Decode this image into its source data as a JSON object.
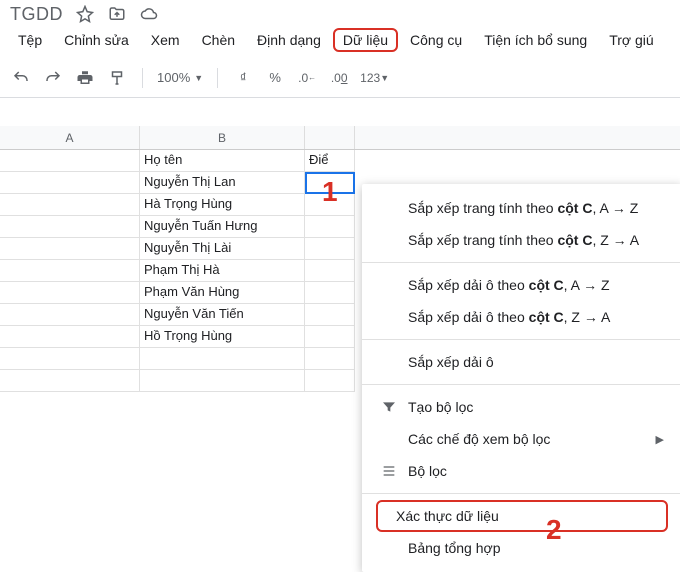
{
  "title": "TGDD",
  "menubar": [
    "Tệp",
    "Chỉnh sửa",
    "Xem",
    "Chèn",
    "Định dạng",
    "Dữ liệu",
    "Công cụ",
    "Tiện ích bổ sung",
    "Trợ giú"
  ],
  "menubar_highlight_index": 5,
  "toolbar": {
    "zoom": "100%",
    "currency": "₫",
    "percent": "%",
    "dec_less": ".0",
    "dec_more": ".00",
    "format123": "123"
  },
  "columns": [
    "A",
    "B",
    "Điể"
  ],
  "col_b_header": "Họ tên",
  "col_c_header": "Điể",
  "rows": [
    "Nguyễn Thị Lan",
    "Hà Trọng Hùng",
    "Nguyễn Tuấn Hưng",
    "Nguyễn Thị Lài",
    "Phạm Thị Hà",
    "Phạm Văn Hùng",
    "Nguyễn Văn Tiến",
    "Hồ Trọng Hùng"
  ],
  "dropdown": {
    "sort_sheet_az_pre": "Sắp xếp trang tính theo ",
    "sort_sheet_za_pre": "Sắp xếp trang tính theo ",
    "sort_range_az_pre": "Sắp xếp dải ô theo ",
    "sort_range_za_pre": "Sắp xếp dải ô theo ",
    "bold_col": "cột C",
    "az_suffix": ", A → Z",
    "za_suffix": ", Z → A",
    "sort_range": "Sắp xếp dải ô",
    "create_filter": "Tạo bộ lọc",
    "filter_views": "Các chế độ xem bộ lọc",
    "slicer": "Bộ lọc",
    "data_validation": "Xác thực dữ liệu",
    "pivot": "Bảng tổng hợp"
  },
  "callouts": {
    "one": "1",
    "two": "2"
  }
}
